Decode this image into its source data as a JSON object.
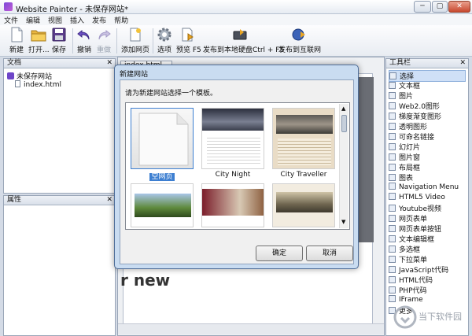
{
  "window": {
    "title": "Website Painter - 未保存网站*",
    "minimize": "─",
    "restore": "▢",
    "close": "✕"
  },
  "menu": [
    "文件",
    "编辑",
    "视图",
    "插入",
    "发布",
    "帮助"
  ],
  "toolbar": {
    "new": "新建",
    "open": "打开...",
    "save": "保存",
    "undo": "撤销",
    "redo": "重做",
    "add_page": "添加网页",
    "options": "选项",
    "preview": "预览 F5",
    "publish_local": "发布到本地硬盘Ctrl + F5",
    "publish_web": "发布到互联网"
  },
  "docs_panel": {
    "title": "文档",
    "close": "✕",
    "site": "未保存网站",
    "page": "index.html"
  },
  "props_panel": {
    "title": "属性",
    "close": "✕"
  },
  "editor_tab": "index.html",
  "editor_text": "r new",
  "toolbox": {
    "title": "工具栏",
    "close": "✕",
    "items": [
      "选择",
      "文本框",
      "图片",
      "Web2.0图形",
      "梯度渐变图形",
      "透明图形",
      "可命名链接",
      "幻灯片",
      "图片窗",
      "布局框",
      "图表",
      "Navigation Menu",
      "HTML5 Video",
      "Youtube视频",
      "网页表单",
      "网页表单按钮",
      "文本编辑框",
      "多选框",
      "下拉菜单",
      "JavaScript代码",
      "HTML代码",
      "PHP代码",
      "IFrame",
      "更多"
    ]
  },
  "dialog": {
    "title": "新建网站",
    "prompt": "请为新建网站选择一个模板。",
    "templates": [
      "空网页",
      "City Night",
      "City Traveller"
    ],
    "ok": "确定",
    "cancel": "取消"
  },
  "watermark": "当下软件园"
}
